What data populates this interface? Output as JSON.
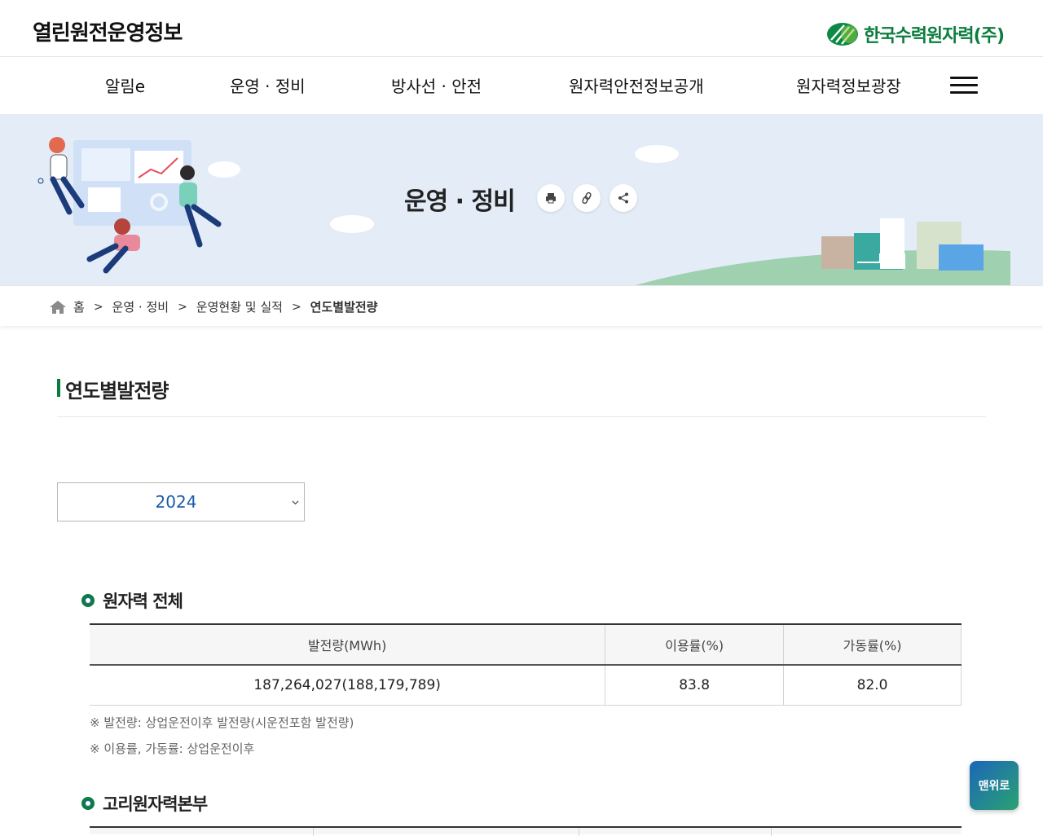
{
  "header": {
    "site_title": "열린원전운영정보",
    "brand_name": "한국수력원자력(주)",
    "brand_color": "#0a7d3e"
  },
  "nav": {
    "items": [
      {
        "label": "알림e"
      },
      {
        "label": "운영 · 정비"
      },
      {
        "label": "방사선 · 안전"
      },
      {
        "label": "원자력안전정보공개"
      },
      {
        "label": "원자력정보광장"
      }
    ],
    "menu_icon": "hamburger-icon"
  },
  "banner": {
    "title": "운영 · 정비",
    "actions": [
      "print-icon",
      "link-icon",
      "share-icon"
    ],
    "background": "#e4ecf8"
  },
  "breadcrumb": {
    "home": "홈",
    "items": [
      "운영 · 정비",
      "운영현황 및 실적",
      "연도별발전량"
    ],
    "separator": ">"
  },
  "page": {
    "title": "연도별발전량"
  },
  "year_select": {
    "value": "2024"
  },
  "sections": [
    {
      "title": "원자력 전체",
      "table": {
        "headers": [
          "발전량(MWh)",
          "이용률(%)",
          "가동률(%)"
        ],
        "rows": [
          [
            "187,264,027(188,179,789)",
            "83.8",
            "82.0"
          ]
        ]
      },
      "notes": [
        "※ 발전량: 상업운전이후 발전량(시운전포함 발전량)",
        "※ 이용률, 가동률: 상업운전이후"
      ]
    },
    {
      "title": "고리원자력본부"
    }
  ],
  "to_top": {
    "label": "맨위로"
  }
}
